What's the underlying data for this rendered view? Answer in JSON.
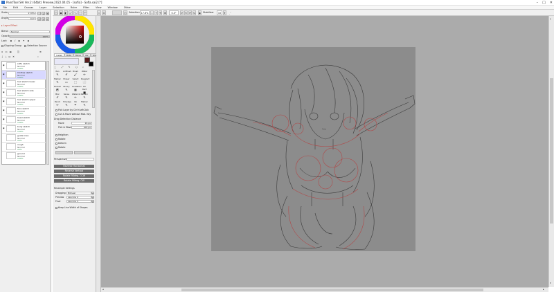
{
  "window": {
    "title": "PaintTool SAI Ver.2 (64bit) Preview.2022.04.05 - [sofia] - Sofia.sai2 [*]",
    "controls": [
      "–",
      "□",
      "✕"
    ]
  },
  "menu": [
    "File",
    "Edit",
    "Canvas",
    "Layer",
    "Selection",
    "Ruler",
    "Filter",
    "View",
    "Window",
    "Other"
  ],
  "toolbar": {
    "selection_label": "Selection",
    "zoom": "17.6%",
    "angle": "0.0°",
    "stabilizer_label": "Stabilizer",
    "stabilizer_value": "10"
  },
  "navigator": {
    "scale_label": "Scale",
    "scale_value": "17.6%",
    "angle_label": "Angle",
    "angle_value": "0.0°"
  },
  "layer_props": {
    "effect_label": "Layer Effect",
    "blend_label": "Blend",
    "blend_value": "Normal",
    "opacity_label": "Opacity",
    "opacity_value": "100%",
    "lock_label": "Lock",
    "clipping_group": "Clipping Group",
    "selection_source": "Selection Source"
  },
  "layers": [
    {
      "name": "sofia sketch",
      "mode": "Normal",
      "opacity": "100%",
      "visible": true,
      "selected": false
    },
    {
      "name": "Clothes sketch",
      "mode": "Normal",
      "opacity": "100%",
      "visible": true,
      "selected": true
    },
    {
      "name": "hair sketch lower",
      "mode": "Normal",
      "opacity": "100%",
      "visible": true,
      "selected": false
    },
    {
      "name": "hair sketch side",
      "mode": "Normal",
      "opacity": "100%",
      "visible": true,
      "selected": false
    },
    {
      "name": "hair sketch upper",
      "mode": "Normal",
      "opacity": "100%",
      "visible": true,
      "selected": false
    },
    {
      "name": "face sketch",
      "mode": "Normal",
      "opacity": "100%",
      "visible": true,
      "selected": false
    },
    {
      "name": "head sketch",
      "mode": "Normal",
      "opacity": "100%",
      "visible": true,
      "selected": false
    },
    {
      "name": "body sketch",
      "mode": "Normal",
      "opacity": "100%",
      "visible": true,
      "selected": false
    },
    {
      "name": "guide lines",
      "mode": "Normal",
      "opacity": "20%",
      "visible": false,
      "selected": false
    },
    {
      "name": "rough",
      "mode": "Normal",
      "opacity": "20%",
      "visible": false,
      "selected": false
    },
    {
      "name": "ground",
      "mode": "Normal",
      "opacity": "100%",
      "visible": false,
      "selected": false
    }
  ],
  "tool_tabs": [
    "Install",
    "Rota",
    "Move",
    "Ver 1",
    "Wdth"
  ],
  "tools": [
    [
      "Pen",
      "AirBrush",
      "Brush",
      "Water"
    ],
    [
      "Marker",
      "Eraser",
      "Select",
      "Deselect"
    ],
    [
      "Bucket",
      "Binary",
      "Gradation",
      "Fill Rect"
    ],
    [
      "Blur",
      "Sense",
      "Watercol",
      "Pattern"
    ],
    [
      "Pencil",
      "Smudge",
      "Ink",
      "Marker"
    ]
  ],
  "move_options": {
    "pick_layer": "Pick Layer by Ctrl+LeftClick",
    "cut_move": "Cut & Move without Mod. Key",
    "drag_title": "Drag Detection Distance",
    "move_label": "Move",
    "move_value": "16 px",
    "pick_move_label": "Pick & Move",
    "pick_move_value": "100 px",
    "checks": [
      "Heighten",
      "Rotate",
      "Deform",
      "Rotate"
    ],
    "perspective_label": "Perspective"
  },
  "actions": [
    "Reverse Horizontal",
    "Reverse Vertical",
    "Rotate 90deg. CCW",
    "Rotate 90deg. CW"
  ],
  "resample": {
    "title": "Resample Settings",
    "dragging_label": "Dragging",
    "dragging_value": "Bilinear",
    "preview_label": "Preview",
    "preview_value": "Lanczos 2",
    "final_label": "Final",
    "final_value": "Lanczos 3",
    "keep_line": "Keep Line Width of Shapes"
  },
  "colors": {
    "primary": "#5a1c1c",
    "secondary": "#000000",
    "canvas_bg": "#8c8c8c",
    "area_bg": "#ababab",
    "sketch": "#3b3b3b",
    "sketch_red": "#b04a4a"
  }
}
